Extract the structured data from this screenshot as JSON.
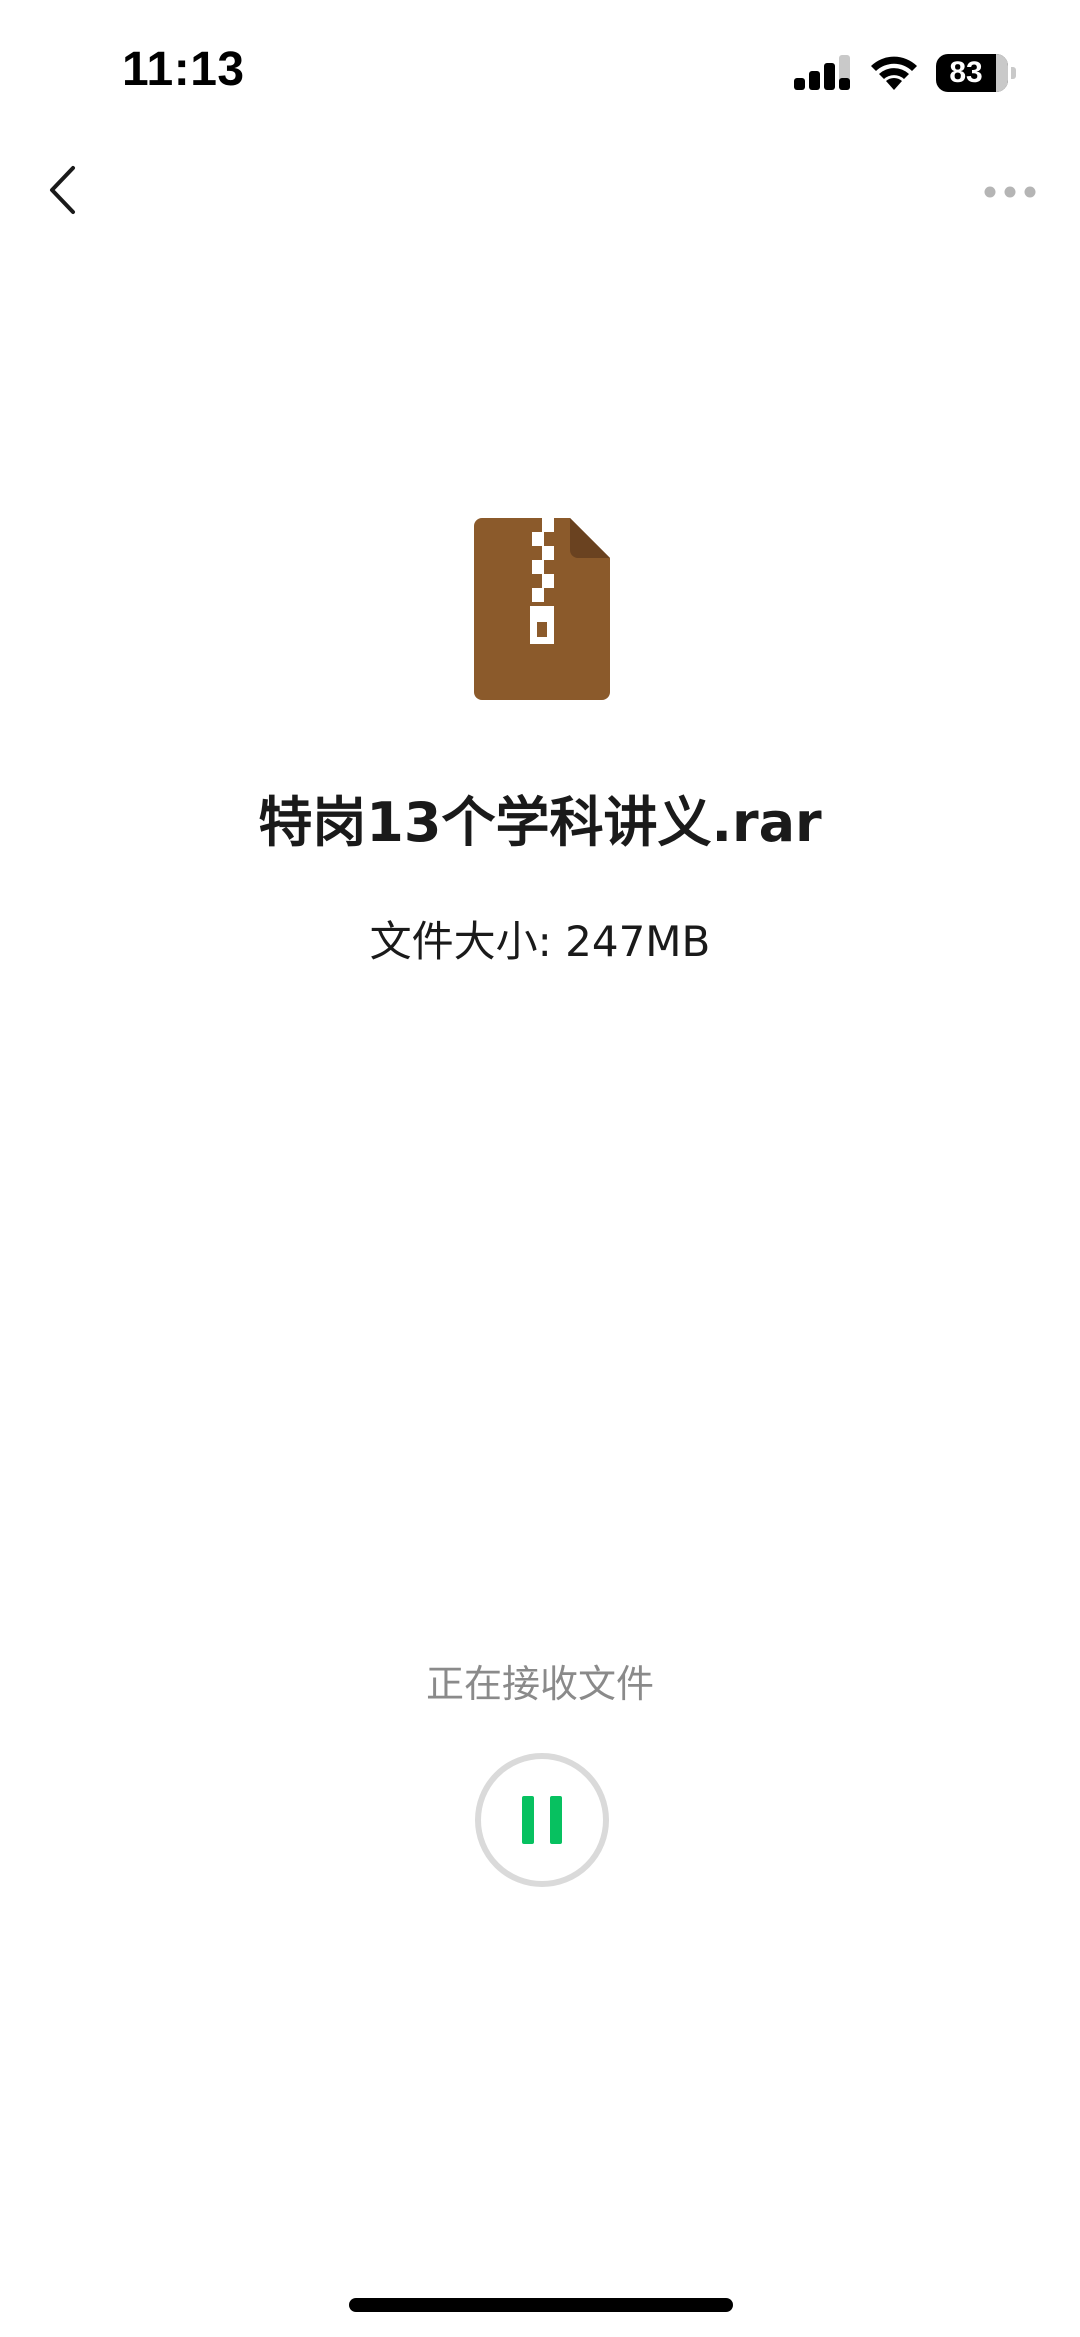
{
  "status_bar": {
    "time": "11:13",
    "battery_level": "83",
    "battery_fraction": 0.83,
    "icons": [
      "signal-icon",
      "wifi-icon",
      "battery-icon"
    ]
  },
  "nav": {
    "back_icon": "chevron-left-icon",
    "more_icon": "more-dots-icon"
  },
  "file": {
    "icon": "zip-archive-file-icon",
    "icon_color": "#8B5A2B",
    "name": "特岗13个学科讲义.rar",
    "size_label": "文件大小:",
    "size_value": "247MB"
  },
  "transfer": {
    "status_text": "正在接收文件",
    "control_icon": "pause-icon",
    "accent_color": "#07C160"
  }
}
